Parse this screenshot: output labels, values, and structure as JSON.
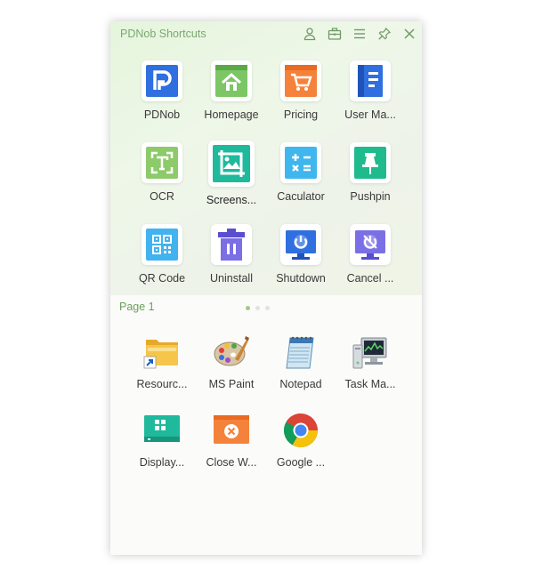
{
  "window": {
    "title": "PDNob Shortcuts",
    "page_label": "Page 1",
    "title_color": "#7aa870"
  },
  "toolbar": {
    "icons": [
      "user-icon",
      "toolbox-icon",
      "menu-icon",
      "pin-icon",
      "close-icon"
    ]
  },
  "shortcuts": [
    {
      "label": "PDNob",
      "icon": "pdnob-logo-icon",
      "color": "#2f6fe0"
    },
    {
      "label": "Homepage",
      "icon": "homepage-icon",
      "color": "#7cc665"
    },
    {
      "label": "Pricing",
      "icon": "pricing-cart-icon",
      "color": "#f5823a"
    },
    {
      "label": "User Ma...",
      "icon": "user-manual-icon",
      "color": "#2f6fe0"
    },
    {
      "label": "OCR",
      "icon": "ocr-icon",
      "color": "#8cca6a"
    },
    {
      "label": "Screens...",
      "icon": "screenshot-icon",
      "color": "#1fb99c"
    },
    {
      "label": "Caculator",
      "icon": "calculator-icon",
      "color": "#3fb6ee"
    },
    {
      "label": "Pushpin",
      "icon": "pushpin-icon",
      "color": "#1fbb8c"
    },
    {
      "label": "QR Code",
      "icon": "qr-code-icon",
      "color": "#40b3f0"
    },
    {
      "label": "Uninstall",
      "icon": "uninstall-trash-icon",
      "color": "#7b6fe6"
    },
    {
      "label": "Shutdown",
      "icon": "shutdown-icon",
      "color": "#2f6fe0"
    },
    {
      "label": "Cancel ...",
      "icon": "cancel-shutdown-icon",
      "color": "#7b6fe6"
    }
  ],
  "desktop_apps": [
    {
      "label": "Resourc...",
      "icon": "resource-folder-icon"
    },
    {
      "label": "MS Paint",
      "icon": "ms-paint-icon"
    },
    {
      "label": "Notepad",
      "icon": "notepad-icon"
    },
    {
      "label": "Task Ma...",
      "icon": "task-manager-icon"
    },
    {
      "label": "Display...",
      "icon": "display-icon"
    },
    {
      "label": "Close W...",
      "icon": "close-window-icon"
    },
    {
      "label": "Google ...",
      "icon": "google-chrome-icon"
    }
  ],
  "pagination": {
    "current": 1,
    "total": 3
  }
}
